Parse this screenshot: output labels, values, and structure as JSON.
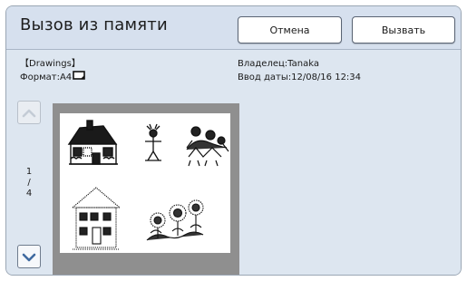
{
  "header": {
    "title": "Вызов из памяти",
    "cancel_label": "Отмена",
    "call_label": "Вызвать"
  },
  "info": {
    "name": "【Drawings】",
    "format_label": "Формат:",
    "format_value": "A4",
    "format_icon": "landscape-page-icon",
    "owner_label": "Владелец:",
    "owner_value": "Tanaka",
    "date_label": "Ввод даты:",
    "date_value": "12/08/16 12:34"
  },
  "pagination": {
    "current": "1",
    "separator": "/",
    "total": "4"
  },
  "colors": {
    "background": "#dde6f0",
    "header": "#d6e0ee",
    "preview_border": "#8f8f8f",
    "scroll_arrow": "#3f6aa0"
  },
  "preview_images": [
    "house-drawing",
    "stick-figure-drawing",
    "children-drawing",
    "cottage-drawing",
    "sunflowers-drawing"
  ]
}
